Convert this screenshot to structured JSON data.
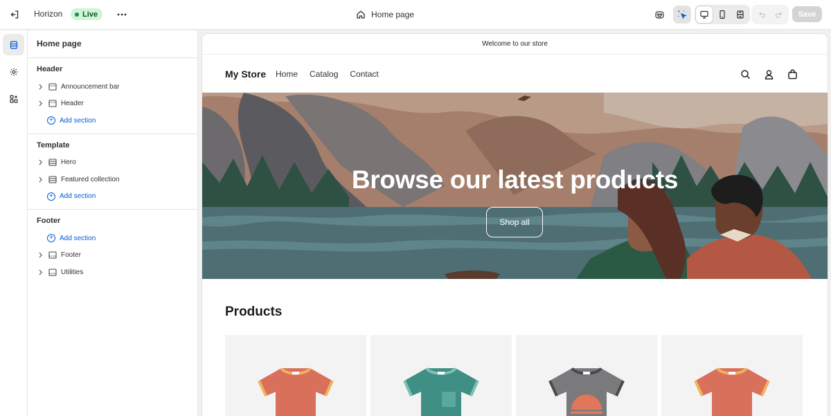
{
  "topbar": {
    "exit_icon": "exit-icon",
    "theme_name": "Horizon",
    "live_badge": "Live",
    "more_icon": "more-horizontal-icon",
    "page_selector": "Home page",
    "save_label": "Save"
  },
  "sidebar": {
    "title": "Home page",
    "groups": [
      {
        "title": "Header",
        "items": [
          {
            "label": "Announcement bar"
          },
          {
            "label": "Header"
          }
        ],
        "add_label": "Add section"
      },
      {
        "title": "Template",
        "items": [
          {
            "label": "Hero"
          },
          {
            "label": "Featured collection"
          }
        ],
        "add_label": "Add section"
      },
      {
        "title": "Footer",
        "add_label": "Add section",
        "items": [
          {
            "label": "Footer"
          },
          {
            "label": "Utilities"
          }
        ]
      }
    ]
  },
  "preview": {
    "announcement": "Welcome to our store",
    "store_name": "My Store",
    "nav_links": [
      "Home",
      "Catalog",
      "Contact"
    ],
    "hero_title": "Browse our latest products",
    "hero_button": "Shop all",
    "products_title": "Products"
  },
  "colors": {
    "accent_blue": "#005bd3",
    "live_green": "#cdf6d3",
    "save_disabled": "#d4d4d4"
  }
}
